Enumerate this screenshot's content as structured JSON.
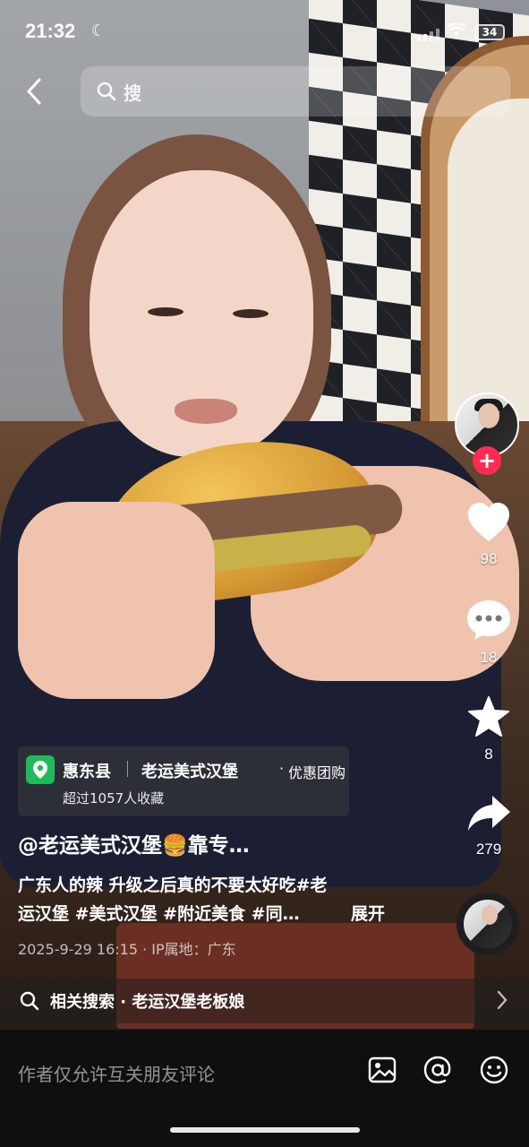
{
  "status_bar": {
    "time": "21:32",
    "battery": "34"
  },
  "header": {
    "search_text": "搜"
  },
  "right_rail": {
    "like_count": "98",
    "comment_count": "18",
    "favorite_count": "8",
    "share_count": "279"
  },
  "poi": {
    "county": "惠东县",
    "shop": "老运美式汉堡",
    "deal": "优惠团购",
    "favorites": "超过1057人收藏"
  },
  "caption": {
    "author": "@老运美式汉堡🍔靠专…",
    "line1": "广东人的辣 升级之后真的不要太好吃#老",
    "line2": "运汉堡 #美式汉堡 #附近美食 #同…",
    "expand": "展开",
    "meta": "2025-9-29 16:15 · IP属地：广东"
  },
  "related": {
    "text": "相关搜索 · 老运汉堡老板娘"
  },
  "comment_bar": {
    "placeholder": "作者仅允许互关朋友评论"
  }
}
